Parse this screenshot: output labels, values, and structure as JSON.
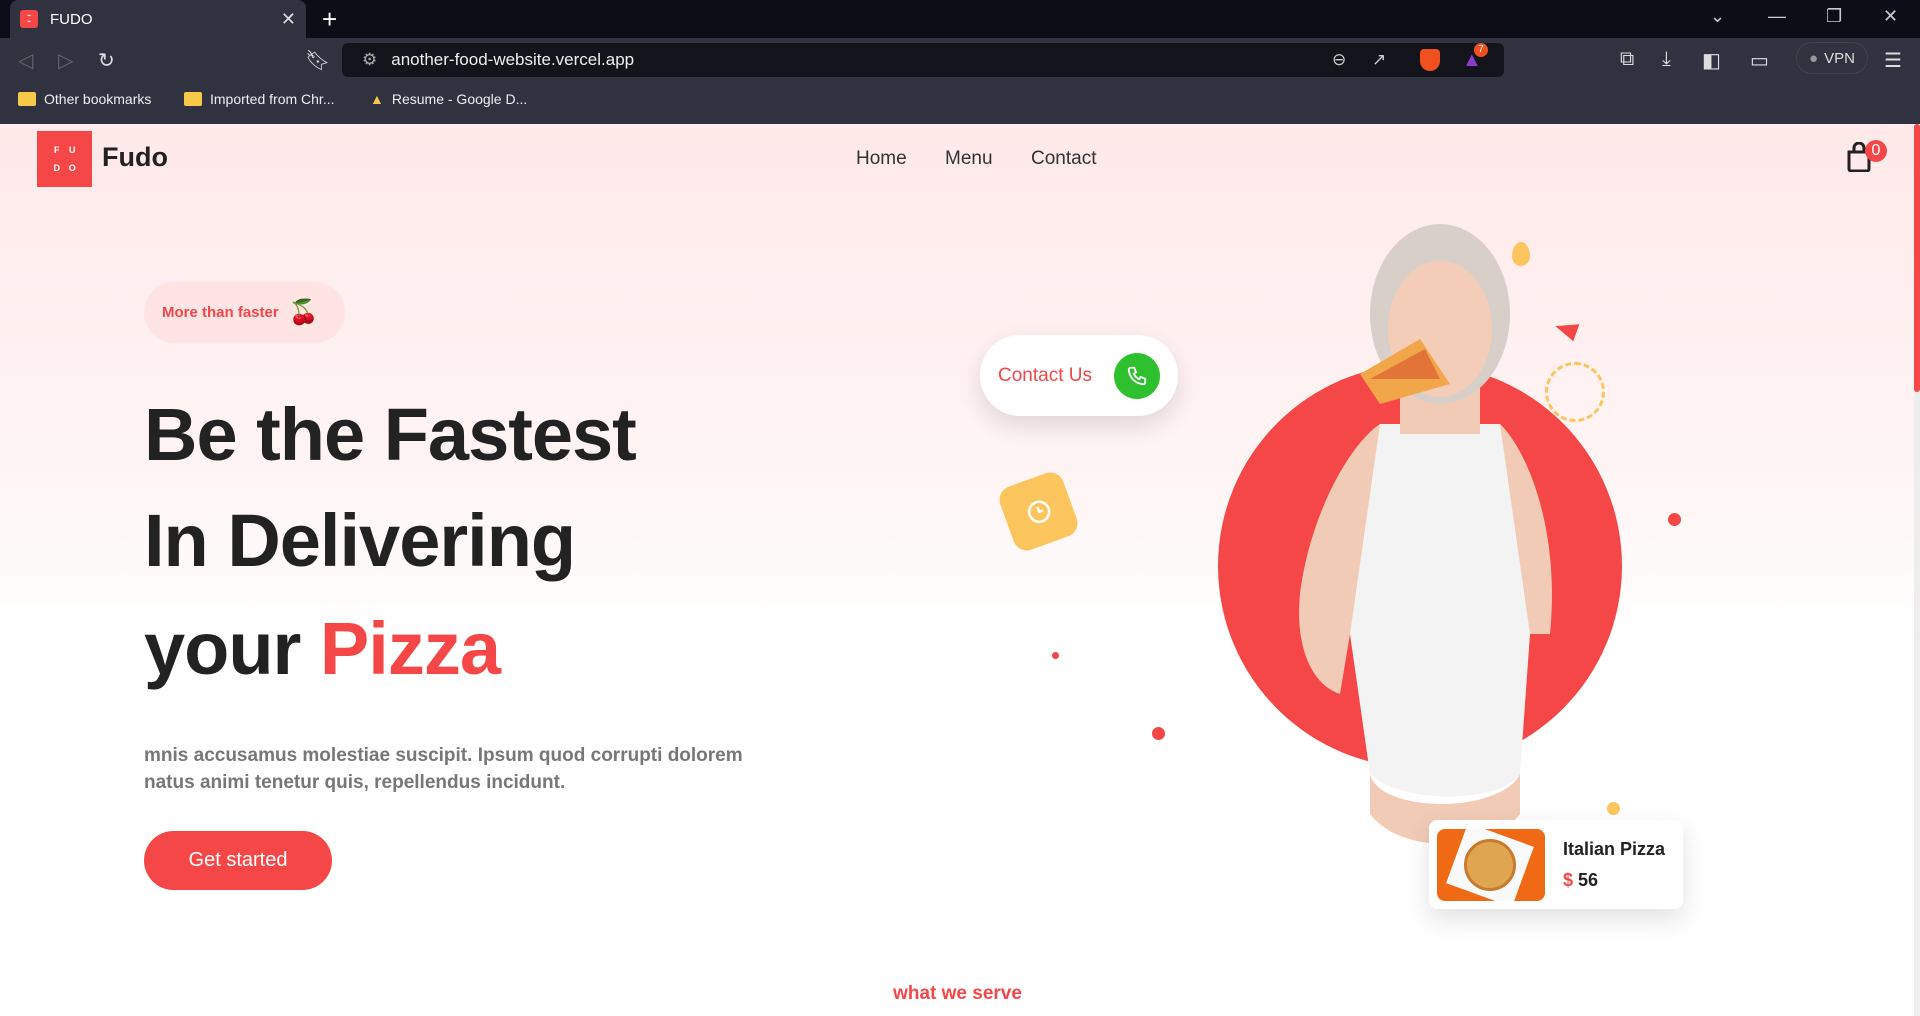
{
  "browser": {
    "tab_title": "FUDO",
    "url": "another-food-website.vercel.app",
    "vpn_label": "VPN",
    "notification_count": "7",
    "bookmarks": [
      "Other bookmarks",
      "Imported from Chr...",
      "Resume - Google D..."
    ]
  },
  "nav": {
    "logo_letters": [
      "F",
      "U",
      "D",
      "O"
    ],
    "brand": "Fudo",
    "links": [
      "Home",
      "Menu",
      "Contact"
    ],
    "cart_count": "0"
  },
  "hero": {
    "badge": "More than faster",
    "badge_emoji": "🍒",
    "line1": "Be the Fastest",
    "line2": "In Delivering",
    "line3_prefix": "your ",
    "line3_highlight": "Pizza",
    "description": "mnis accusamus molestiae suscipit. Ipsum quod corrupti dolorem natus animi tenetur quis, repellendus incidunt.",
    "cta": "Get started"
  },
  "contact": {
    "label": "Contact Us"
  },
  "card": {
    "title": "Italian Pizza",
    "currency": "$",
    "price": "56"
  },
  "section": {
    "eyebrow": "what we serve"
  },
  "colors": {
    "accent": "#f54748",
    "yellow": "#fdc55e",
    "green": "#2ec02e"
  }
}
